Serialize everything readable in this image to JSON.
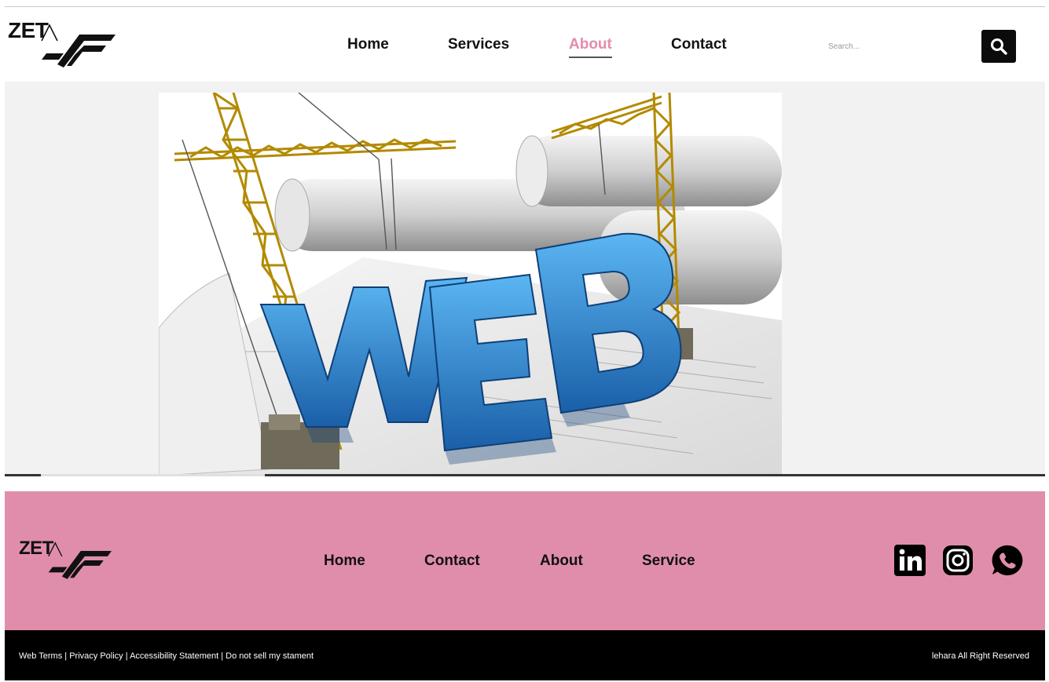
{
  "brand": {
    "logo_text": "ZET"
  },
  "header": {
    "nav": [
      {
        "label": "Home",
        "active": false
      },
      {
        "label": "Services",
        "active": false
      },
      {
        "label": "About",
        "active": true
      },
      {
        "label": "Contact",
        "active": false
      }
    ],
    "search_placeholder": "Search...",
    "search_icon": "search-icon",
    "active_color": "#e48cae"
  },
  "hero": {
    "image_text": "WEB"
  },
  "footer": {
    "nav": [
      {
        "label": "Home"
      },
      {
        "label": "Contact"
      },
      {
        "label": "About"
      },
      {
        "label": "Service"
      }
    ],
    "social": [
      "linkedin-icon",
      "instagram-icon",
      "whatsapp-icon"
    ],
    "background": "#e08dab"
  },
  "bottom_bar": {
    "links": [
      "Web Terms",
      "Privacy Policy",
      "Accessibility Statement",
      "Do not sell my stament"
    ],
    "copyright": "lehara All Right Reserved"
  }
}
